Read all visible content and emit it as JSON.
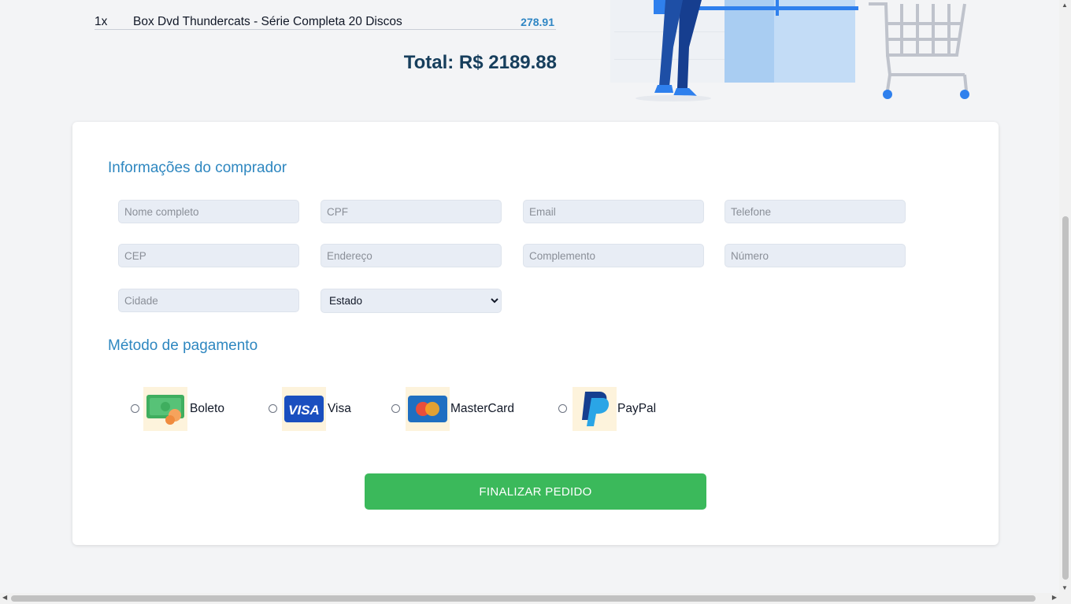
{
  "order": {
    "item": {
      "qty": "1x",
      "name": "Box Dvd Thundercats - Série Completa 20 Discos",
      "price": "278.91"
    },
    "total": "Total: R$ 2189.88"
  },
  "buyer": {
    "title": "Informações do comprador",
    "fields": {
      "nome": "Nome completo",
      "cpf": "CPF",
      "email": "Email",
      "telefone": "Telefone",
      "cep": "CEP",
      "endereco": "Endereço",
      "complemento": "Complemento",
      "numero": "Número",
      "cidade": "Cidade"
    },
    "estado": {
      "selected": "Estado"
    }
  },
  "payment": {
    "title": "Método de pagamento",
    "options": [
      {
        "label": "Boleto",
        "icon": "money-icon"
      },
      {
        "label": "Visa",
        "icon": "visa-icon"
      },
      {
        "label": "MasterCard",
        "icon": "mastercard-icon"
      },
      {
        "label": "PayPal",
        "icon": "paypal-icon"
      }
    ]
  },
  "submit_label": "FINALIZAR PEDIDO",
  "colors": {
    "accent": "#2e87c0",
    "submit": "#3bb95b",
    "total": "#163e5c"
  }
}
